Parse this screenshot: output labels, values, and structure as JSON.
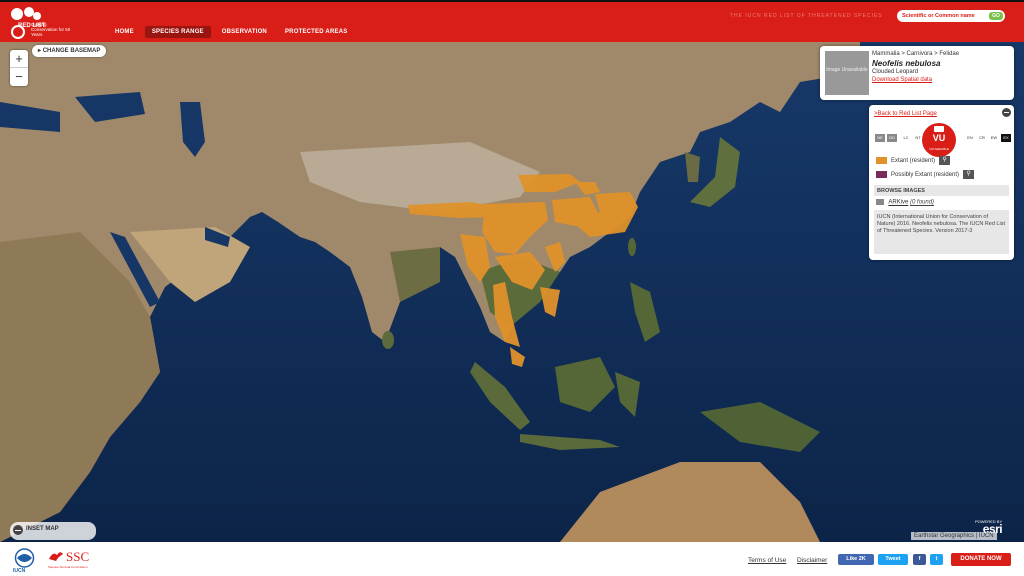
{
  "header": {
    "logo_text": "RED LIST",
    "tagline": "Guiding Conservation for 50 Years",
    "title": "THE IUCN RED LIST OF THREATENED SPECIES",
    "nav": [
      "HOME",
      "SPECIES RANGE",
      "OBSERVATION",
      "PROTECTED AREAS"
    ],
    "active_nav": "SPECIES RANGE",
    "search_placeholder": "Scientific or Common name",
    "search_go": "GO"
  },
  "map": {
    "zoom_in": "+",
    "zoom_out": "−",
    "change_basemap": "CHANGE BASEMAP",
    "inset_map": "INSET MAP",
    "powered_by": "POWERED BY",
    "esri": "esri",
    "attribution": "Earthstar Geographics | IUCN"
  },
  "species": {
    "image_placeholder": "Image Unavailable",
    "taxonomy": "Mammalia > Carnivora > Felidae",
    "scientific_name": "Neofelis nebulosa",
    "common_name": "Clouded Leopard",
    "download_link": "Download Spatial data"
  },
  "panel": {
    "back_link": ">Back to Red List Page",
    "categories": [
      "NE",
      "DD",
      "LC",
      "NT",
      "VU",
      "EN",
      "CR",
      "EW",
      "EX"
    ],
    "status": "VU",
    "status_label": "VULNERABLE",
    "legend": [
      {
        "label": "Extant (resident)",
        "color": "#e0922a"
      },
      {
        "label": "Possibly Extant (resident)",
        "color": "#7b2a5c"
      }
    ],
    "browse_images": "BROWSE IMAGES",
    "arkive": "ARKive",
    "arkive_found": "(0 found)",
    "citation": "IUCN (International Union for Conservation of Nature) 2016. Neofelis nebulosa. The IUCN Red List of Threatened Species. Version 2017-3"
  },
  "footer": {
    "iucn": "IUCN",
    "ssc": "SSC",
    "ssc_sub": "Species Survival Commission",
    "terms": "Terms of Use",
    "disclaimer": "Disclaimer",
    "like": "Like 2K",
    "tweet": "Tweet",
    "donate": "DONATE NOW"
  },
  "colors": {
    "brand_red": "#d91e17",
    "ocean": "#0f2c55",
    "land": "#a08a68",
    "range": "#e0922a"
  }
}
